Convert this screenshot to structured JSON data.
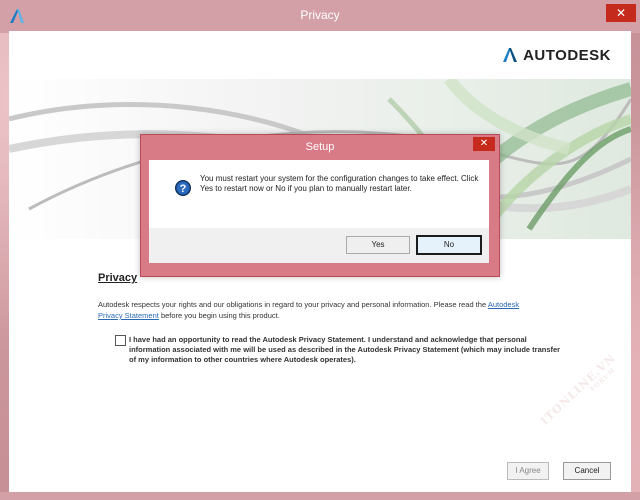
{
  "window": {
    "title": "Privacy",
    "close_glyph": "✕"
  },
  "brand": {
    "name": "AUTODESK"
  },
  "privacy": {
    "heading": "Privacy",
    "text_before_link": "Autodesk respects your rights and our obligations in regard to your privacy and personal information. Please read the",
    "link": "Autodesk Privacy Statement",
    "text_after_link": "before you begin using this product.",
    "checkbox_label": "I have had an opportunity to read the Autodesk Privacy Statement. I understand and acknowledge that personal information associated with me will be used as described in the Autodesk Privacy Statement (which may include transfer of my information to other countries where Autodesk operates).",
    "checkbox_checked": false
  },
  "buttons": {
    "agree": "I Agree",
    "cancel": "Cancel"
  },
  "dialog": {
    "title": "Setup",
    "close_glyph": "✕",
    "message": "You must restart your system for the configuration changes to take effect. Click Yes to restart now or No if you plan to manually restart later.",
    "yes": "Yes",
    "no": "No",
    "icon": "question-icon"
  },
  "watermark": {
    "text": "ITONLINE.VN",
    "sub": "FORUM"
  },
  "colors": {
    "dialog_title_bar": "#d87b86",
    "close_button": "#c42b1c",
    "link": "#2a6ab5",
    "brand_accent": "#1a7dc4"
  }
}
